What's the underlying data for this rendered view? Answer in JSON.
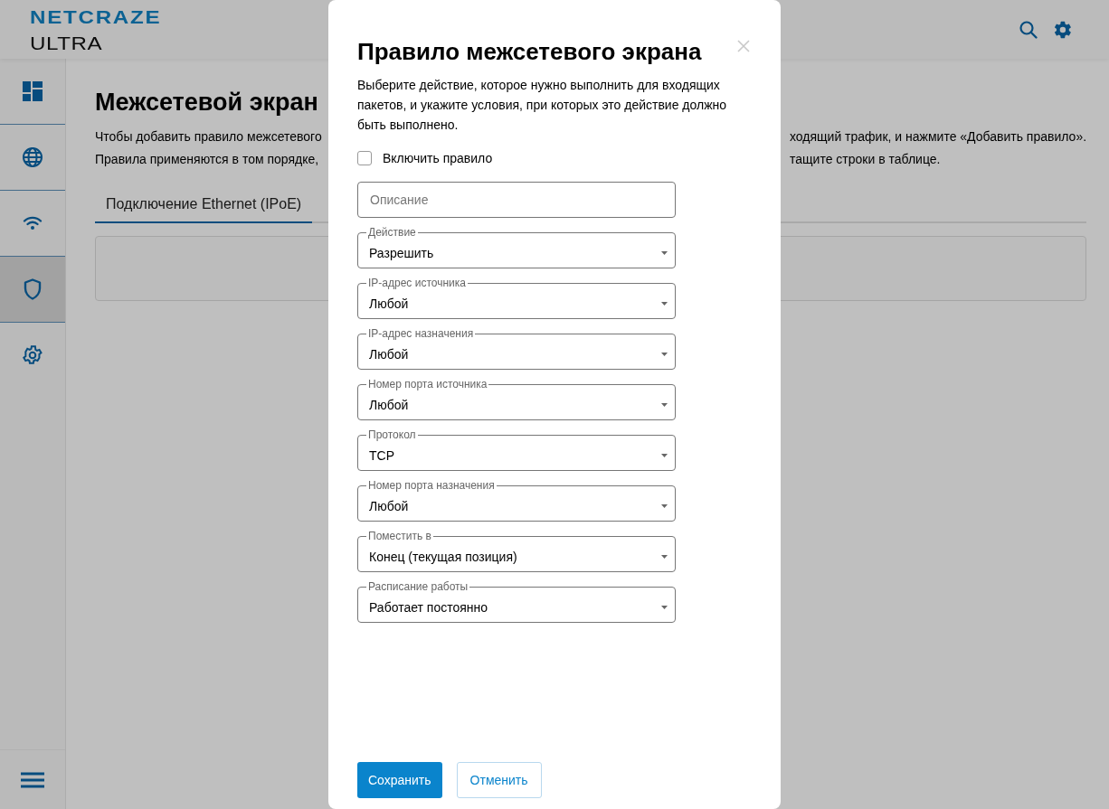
{
  "header": {
    "logo_top": "NETCRAZE",
    "logo_bottom": "ULTRA"
  },
  "sidebar": {
    "items": [
      {
        "kind": "dashboard",
        "selected": false
      },
      {
        "kind": "globe",
        "selected": false
      },
      {
        "kind": "wifi",
        "selected": false
      },
      {
        "kind": "shield",
        "selected": true
      },
      {
        "kind": "gear",
        "selected": false
      }
    ]
  },
  "page": {
    "title": "Межсетевой экран",
    "description_lines": [
      {
        "left": "Чтобы добавить правило межсетевого",
        "right": "ходящий трафик, и нажмите «Добавить правило»."
      },
      {
        "left": "Правила применяются в том порядке,",
        "right": "тащите строки в таблице."
      }
    ],
    "tabs": [
      {
        "label": "Подключение Ethernet (IPoE)",
        "selected": true
      }
    ]
  },
  "dialog": {
    "title": "Правило межсетевого экрана",
    "description": "Выберите действие, которое нужно выполнить для входящих пакетов, и укажите условия, при которых это действие должно быть выполнено.",
    "enable": {
      "label": "Включить правило",
      "checked": false
    },
    "fields": [
      {
        "kind": "text",
        "placeholder": "Описание"
      },
      {
        "kind": "select",
        "label": "Действие",
        "value": "Разрешить"
      },
      {
        "kind": "select",
        "label": "IP-адрес источника",
        "value": "Любой"
      },
      {
        "kind": "select",
        "label": "IP-адрес назначения",
        "value": "Любой"
      },
      {
        "kind": "select",
        "label": "Номер порта источника",
        "value": "Любой"
      },
      {
        "kind": "select",
        "label": "Протокол",
        "value": "TCP"
      },
      {
        "kind": "select",
        "label": "Номер порта назначения",
        "value": "Любой"
      },
      {
        "kind": "select",
        "label": "Поместить в",
        "value": "Конец (текущая позиция)"
      },
      {
        "kind": "select",
        "label": "Расписание работы",
        "value": "Работает постоянно"
      }
    ],
    "buttons": [
      {
        "kind": "primary",
        "label": "Сохранить"
      },
      {
        "kind": "secondary",
        "label": "Отменить"
      }
    ]
  }
}
